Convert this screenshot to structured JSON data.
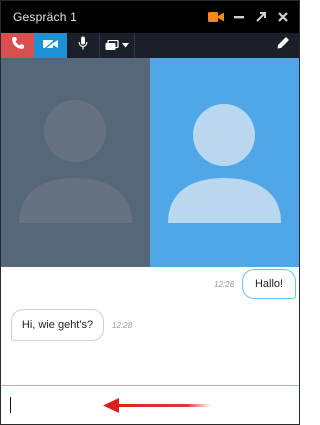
{
  "window": {
    "title": "Gespräch 1"
  },
  "titlebar_icons": [
    "video-camera-icon",
    "minimize-icon",
    "maximize-icon",
    "close-icon"
  ],
  "toolbar": {
    "items": [
      "hangup-phone-icon",
      "video-icon",
      "microphone-icon",
      "screen-share-icon",
      "pencil-icon"
    ]
  },
  "colors": {
    "titlebar_bg": "#000000",
    "toolbar_bg": "#1a1f29",
    "hangup_red": "#d94f4f",
    "video_active_blue": "#1e90d6",
    "camera_orange": "#f08a1c",
    "remote_video_bg": "#56677a",
    "local_video_bg": "#4fa7e8",
    "outgoing_bubble_border": "#6cc2e8",
    "input_border": "#7fc6e6",
    "annotation_arrow_red": "#e02020"
  },
  "messages": [
    {
      "direction": "outgoing",
      "time": "12:28",
      "text": "Hallo!"
    },
    {
      "direction": "incoming",
      "time": "12:28",
      "text": "Hi, wie geht's?"
    }
  ],
  "composer": {
    "value": ""
  }
}
